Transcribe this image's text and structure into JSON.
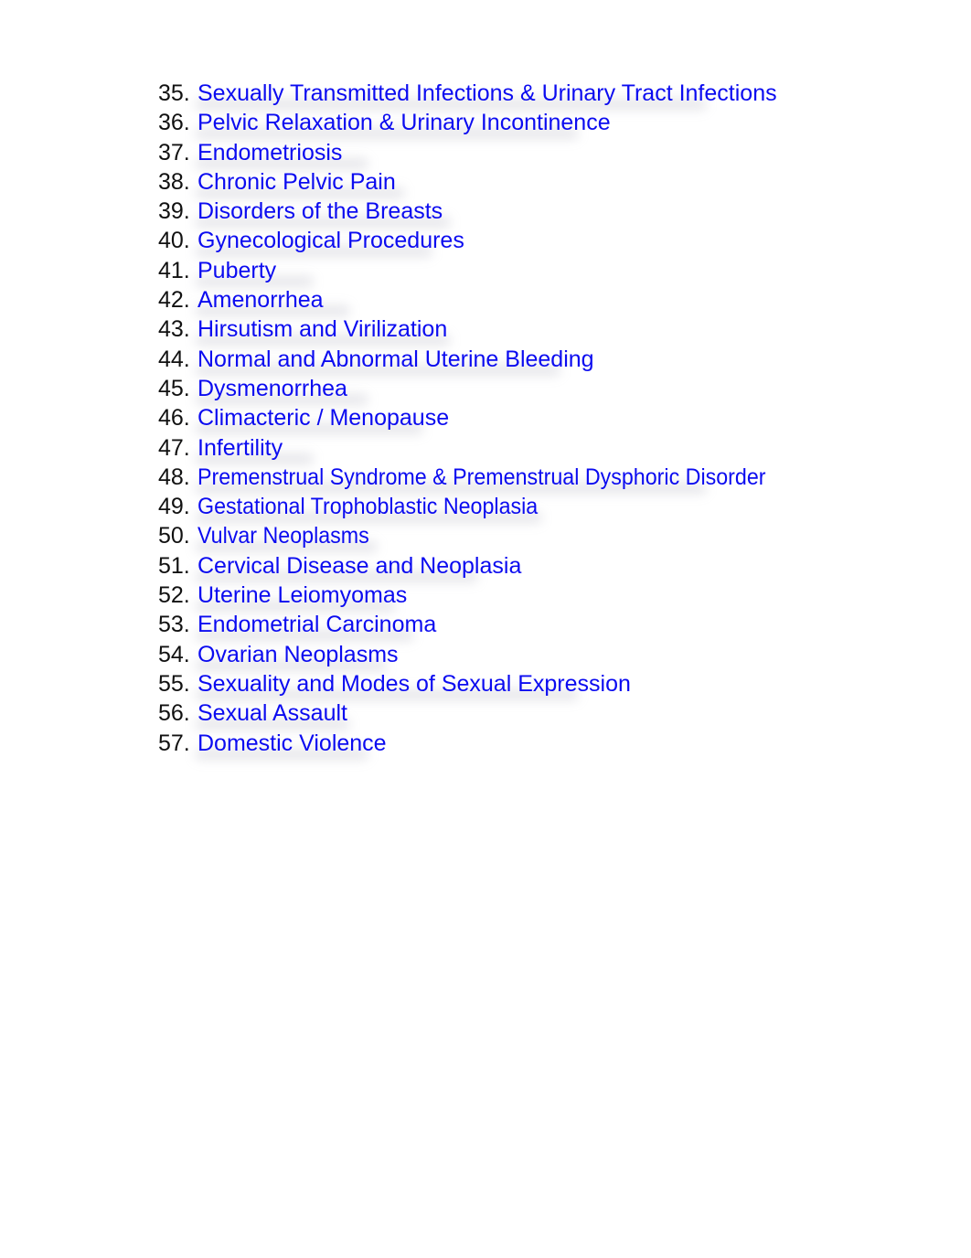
{
  "document": {
    "toc": [
      {
        "number": "35.",
        "title": "Sexually Transmitted Infections & Urinary Tract Infections"
      },
      {
        "number": "36.",
        "title": "Pelvic Relaxation & Urinary Incontinence"
      },
      {
        "number": "37.",
        "title": "Endometriosis"
      },
      {
        "number": "38.",
        "title": "Chronic Pelvic Pain"
      },
      {
        "number": "39.",
        "title": "Disorders of the Breasts"
      },
      {
        "number": "40.",
        "title": "Gynecological Procedures"
      },
      {
        "number": "41.",
        "title": "Puberty"
      },
      {
        "number": "42.",
        "title": "Amenorrhea"
      },
      {
        "number": "43.",
        "title": "Hirsutism and Virilization"
      },
      {
        "number": "44.",
        "title": "Normal and Abnormal Uterine Bleeding"
      },
      {
        "number": "45.",
        "title": "Dysmenorrhea"
      },
      {
        "number": "46.",
        "title": "Climacteric / Menopause"
      },
      {
        "number": "47.",
        "title": "Infertility"
      },
      {
        "number": "48.",
        "title": "Premenstrual Syndrome & Premenstrual Dysphoric Disorder"
      },
      {
        "number": "49.",
        "title": "Gestational Trophoblastic Neoplasia"
      },
      {
        "number": "50.",
        "title": "Vulvar Neoplasms"
      },
      {
        "number": "51.",
        "title": "Cervical Disease and Neoplasia"
      },
      {
        "number": "52.",
        "title": "Uterine Leiomyomas"
      },
      {
        "number": "53.",
        "title": "Endometrial Carcinoma"
      },
      {
        "number": "54.",
        "title": "Ovarian Neoplasms"
      },
      {
        "number": "55.",
        "title": "Sexuality and Modes of Sexual Expression"
      },
      {
        "number": "56.",
        "title": "Sexual Assault"
      },
      {
        "number": "57.",
        "title": "Domestic Violence"
      }
    ]
  },
  "colors": {
    "link": "#0b0bf0",
    "number": "#111111",
    "background": "#ffffff"
  }
}
